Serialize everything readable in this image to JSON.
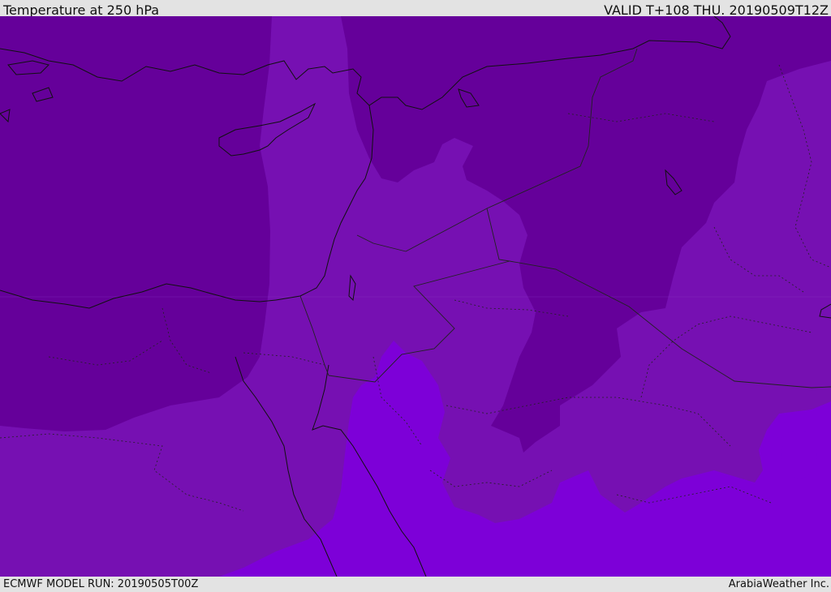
{
  "header": {
    "title": "Temperature at 250 hPa",
    "valid_time": "VALID T+108 THU. 20190509T12Z"
  },
  "footer": {
    "model_run": "ECMWF MODEL RUN: 20190505T00Z",
    "credit": "ArabiaWeather Inc."
  },
  "colors": {
    "coldest": "#65009a",
    "mid": "#7610b2",
    "warm": "#7d00d8",
    "coastline": "#111111",
    "border": "#222222"
  }
}
